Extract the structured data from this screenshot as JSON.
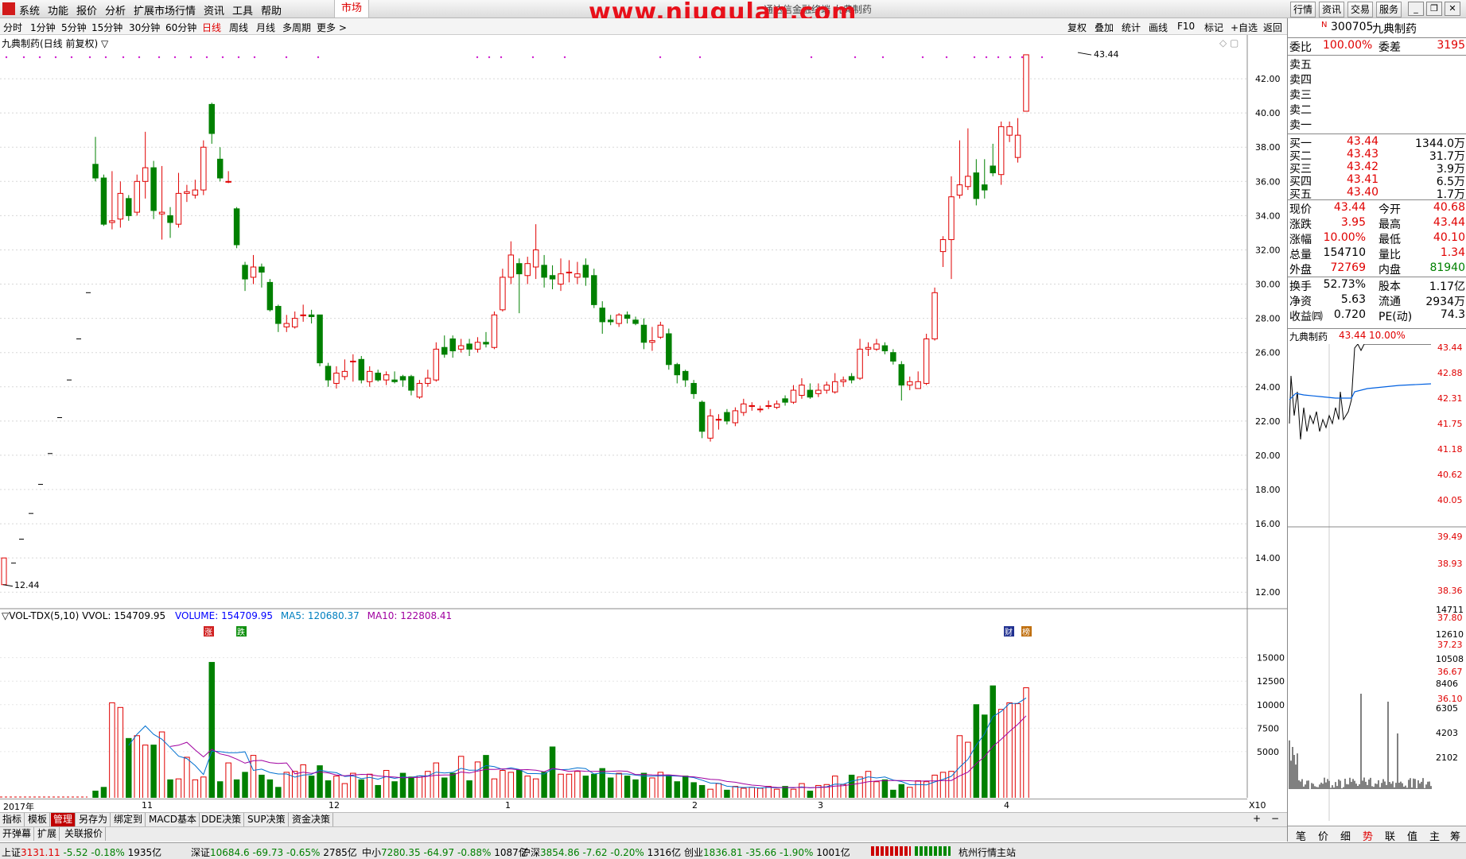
{
  "menu": [
    "系统",
    "功能",
    "报价",
    "分析",
    "扩展市场行情",
    "资讯",
    "工具",
    "帮助"
  ],
  "market": "市场",
  "watermark": "www.niugulan.com",
  "subtitle": "通达信金融终端 九典制药",
  "top_right_buttons": [
    "行情",
    "资讯",
    "交易",
    "服务"
  ],
  "periods": [
    "分时",
    "1分钟",
    "5分钟",
    "15分钟",
    "30分钟",
    "60分钟",
    "日线",
    "周线",
    "月线",
    "多周期",
    "更多 >"
  ],
  "active_period": "日线",
  "toolbar": [
    "复权",
    "叠加",
    "统计",
    "画线",
    "F10",
    "标记",
    "+自选",
    "返回"
  ],
  "chart": {
    "title": "九典制药(日线 前复权) ▽",
    "y_ticks": [
      "42.00",
      "40.00",
      "38.00",
      "36.00",
      "34.00",
      "32.00",
      "30.00",
      "28.00",
      "26.00",
      "24.00",
      "22.00",
      "20.00",
      "18.00",
      "16.00",
      "14.00",
      "12.00"
    ],
    "high_label": "43.44",
    "low_label": "12.44",
    "x_labels": [
      "2017年",
      "11",
      "12",
      "1",
      "2",
      "3",
      "4"
    ],
    "markers": [
      "涨",
      "跌",
      "财",
      "榜"
    ]
  },
  "volume": {
    "legend_name": "▽VOL-TDX(5,10) VVOL: 154709.95",
    "legend_volume": "VOLUME: 154709.95",
    "legend_ma5": "MA5: 120680.37",
    "legend_ma10": "MA10: 122808.41",
    "y_ticks": [
      "15000",
      "12500",
      "10000",
      "7500",
      "5000"
    ],
    "unit": "X10"
  },
  "tabs1": [
    "指标",
    "模板",
    "管理",
    "另存为",
    "绑定到",
    "MACD基本",
    "DDE决策",
    "SUP决策",
    "资金决策"
  ],
  "tabs2": [
    "开弹幕",
    "扩展",
    "关联报价"
  ],
  "status": {
    "sh": {
      "name": "上证",
      "value": "3131.11",
      "chg": "-5.52",
      "pct": "-0.18%",
      "amt": "1935亿"
    },
    "sz": {
      "name": "深证",
      "value": "10684.6",
      "chg": "-69.73",
      "pct": "-0.65%",
      "amt": "2785亿"
    },
    "zx": {
      "name": "中小",
      "value": "7280.35",
      "chg": "-64.97",
      "pct": "-0.88%",
      "amt": "1087亿"
    },
    "hs": {
      "name": "沪深",
      "value": "3854.86",
      "chg": "-7.62",
      "pct": "-0.20%",
      "amt": "1316亿"
    },
    "cy": {
      "name": "创业",
      "value": "1836.81",
      "chg": "-35.66",
      "pct": "-1.90%",
      "amt": "1001亿"
    },
    "station": "杭州行情主站"
  },
  "quote": {
    "code": "300705",
    "name": "九典制药",
    "weibi_label": "委比",
    "weibi": "100.00%",
    "weicha_label": "委差",
    "weicha": "3195",
    "sells": [
      {
        "label": "卖五",
        "p": "",
        "v": ""
      },
      {
        "label": "卖四",
        "p": "",
        "v": ""
      },
      {
        "label": "卖三",
        "p": "",
        "v": ""
      },
      {
        "label": "卖二",
        "p": "",
        "v": ""
      },
      {
        "label": "卖一",
        "p": "",
        "v": ""
      }
    ],
    "buys": [
      {
        "label": "买一",
        "p": "43.44",
        "v": "1344.0万"
      },
      {
        "label": "买二",
        "p": "43.43",
        "v": "31.7万"
      },
      {
        "label": "买三",
        "p": "43.42",
        "v": "3.9万"
      },
      {
        "label": "买四",
        "p": "43.41",
        "v": "6.5万"
      },
      {
        "label": "买五",
        "p": "43.40",
        "v": "1.7万"
      }
    ],
    "stats": [
      {
        "l1": "现价",
        "v1": "43.44",
        "l2": "今开",
        "v2": "40.68"
      },
      {
        "l1": "涨跌",
        "v1": "3.95",
        "l2": "最高",
        "v2": "43.44"
      },
      {
        "l1": "涨幅",
        "v1": "10.00%",
        "l2": "最低",
        "v2": "40.10"
      },
      {
        "l1": "总量",
        "v1": "154710",
        "l2": "量比",
        "v2": "1.34"
      },
      {
        "l1": "外盘",
        "v1": "72769",
        "l2": "内盘",
        "v2": "81940"
      }
    ],
    "stats2": [
      {
        "l1": "换手",
        "v1": "52.73%",
        "l2": "股本",
        "v2": "1.17亿"
      },
      {
        "l1": "净资",
        "v1": "5.63",
        "l2": "流通",
        "v2": "2934万"
      },
      {
        "l1": "收益㈣",
        "v1": "0.720",
        "l2": "PE(动)",
        "v2": "74.3"
      }
    ],
    "mini_title": "九典制药",
    "mini_price": "43.44",
    "mini_pct": "10.00%",
    "mini_prices": [
      "43.44",
      "42.88",
      "42.31",
      "41.75",
      "41.18",
      "40.62",
      "40.05",
      "39.49",
      "38.93",
      "38.36",
      "37.80",
      "37.23",
      "36.67",
      "36.10"
    ],
    "mini_vols": [
      "14711",
      "12610",
      "10508",
      "8406",
      "6305",
      "4203",
      "2102"
    ],
    "bottom_tabs": [
      "笔",
      "价",
      "细",
      "势",
      "联",
      "值",
      "主",
      "筹"
    ]
  },
  "chart_data": {
    "type": "candlestick",
    "note": "",
    "candles": [
      [
        37.0,
        36.2,
        38.6,
        36.0
      ],
      [
        36.2,
        33.5,
        36.4,
        33.4
      ],
      [
        33.6,
        33.7,
        36.6,
        33.2
      ],
      [
        33.8,
        35.3,
        36.0,
        33.3
      ],
      [
        35.0,
        34.0,
        35.2,
        33.7
      ],
      [
        34.2,
        36.0,
        36.4,
        34.0
      ],
      [
        36.0,
        36.8,
        38.9,
        35.0
      ],
      [
        36.8,
        34.3,
        37.2,
        33.8
      ],
      [
        34.1,
        34.2,
        36.9,
        32.6
      ],
      [
        34.0,
        33.6,
        34.5,
        32.7
      ],
      [
        33.5,
        35.3,
        36.5,
        33.3
      ],
      [
        35.3,
        35.4,
        35.8,
        34.8
      ],
      [
        35.2,
        35.5,
        36.1,
        35.0
      ],
      [
        35.5,
        38.0,
        38.4,
        35.2
      ],
      [
        40.5,
        38.8,
        40.6,
        38.2
      ],
      [
        37.3,
        36.2,
        38.0,
        36.0
      ],
      [
        36.0,
        36.0,
        36.6,
        35.9
      ],
      [
        34.4,
        32.3,
        34.5,
        32.1
      ],
      [
        31.1,
        30.3,
        31.3,
        29.6
      ],
      [
        30.4,
        31.0,
        31.7,
        30.0
      ],
      [
        31.0,
        30.7,
        31.2,
        29.8
      ],
      [
        30.1,
        28.5,
        30.3,
        28.4
      ],
      [
        28.7,
        27.7,
        28.8,
        27.2
      ],
      [
        27.5,
        27.7,
        28.2,
        27.2
      ],
      [
        27.5,
        28.0,
        28.4,
        27.4
      ],
      [
        28.2,
        28.2,
        28.8,
        27.8
      ],
      [
        28.2,
        28.1,
        28.5,
        27.7
      ],
      [
        28.2,
        25.4,
        28.2,
        25.2
      ],
      [
        25.2,
        24.4,
        25.4,
        24.0
      ],
      [
        24.2,
        24.8,
        25.2,
        23.9
      ],
      [
        24.6,
        24.9,
        25.6,
        24.4
      ],
      [
        25.5,
        25.5,
        25.9,
        24.3
      ],
      [
        25.6,
        24.4,
        25.8,
        24.2
      ],
      [
        24.3,
        24.9,
        25.2,
        24.0
      ],
      [
        24.8,
        24.4,
        25.0,
        24.3
      ],
      [
        24.4,
        24.7,
        24.9,
        24.1
      ],
      [
        24.4,
        24.3,
        24.9,
        24.2
      ],
      [
        24.6,
        24.4,
        24.7,
        24.0
      ],
      [
        24.6,
        23.8,
        24.7,
        23.5
      ],
      [
        23.4,
        24.2,
        24.4,
        23.3
      ],
      [
        24.2,
        24.5,
        25.0,
        24.0
      ],
      [
        24.4,
        26.2,
        26.6,
        24.3
      ],
      [
        26.3,
        25.9,
        27.0,
        25.7
      ],
      [
        26.8,
        26.1,
        27.0,
        25.7
      ],
      [
        26.2,
        26.4,
        26.8,
        26.0
      ],
      [
        26.5,
        26.2,
        26.8,
        25.8
      ],
      [
        26.2,
        26.6,
        26.9,
        26.0
      ],
      [
        26.6,
        26.5,
        27.2,
        26.3
      ],
      [
        26.3,
        28.2,
        28.4,
        26.2
      ],
      [
        28.5,
        30.4,
        30.9,
        28.4
      ],
      [
        30.4,
        31.7,
        32.5,
        30.0
      ],
      [
        31.2,
        30.6,
        31.5,
        28.3
      ],
      [
        30.5,
        31.2,
        31.6,
        30.0
      ],
      [
        31.0,
        32.0,
        33.5,
        30.3
      ],
      [
        31.1,
        30.4,
        31.7,
        29.8
      ],
      [
        30.5,
        30.3,
        31.1,
        29.7
      ],
      [
        30.0,
        30.6,
        31.5,
        29.6
      ],
      [
        30.7,
        30.7,
        31.4,
        30.1
      ],
      [
        30.4,
        30.6,
        31.3,
        30.0
      ],
      [
        31.1,
        30.4,
        31.5,
        29.9
      ],
      [
        30.5,
        28.8,
        30.9,
        28.6
      ],
      [
        28.6,
        27.8,
        29.0,
        27.1
      ],
      [
        27.9,
        27.8,
        28.2,
        27.6
      ],
      [
        27.7,
        28.2,
        28.3,
        27.5
      ],
      [
        28.2,
        28.0,
        28.4,
        27.7
      ],
      [
        27.9,
        27.7,
        28.1,
        27.6
      ],
      [
        27.6,
        26.6,
        28.0,
        26.2
      ],
      [
        26.6,
        26.7,
        27.5,
        26.1
      ],
      [
        26.9,
        27.6,
        27.8,
        26.8
      ],
      [
        27.1,
        25.3,
        27.4,
        25.0
      ],
      [
        25.3,
        24.7,
        25.4,
        24.2
      ],
      [
        24.9,
        24.4,
        25.0,
        24.0
      ],
      [
        24.2,
        23.6,
        24.4,
        23.3
      ],
      [
        23.1,
        21.4,
        23.2,
        21.0
      ],
      [
        21.0,
        22.3,
        22.7,
        20.8
      ],
      [
        22.1,
        22.1,
        22.4,
        21.5
      ],
      [
        22.5,
        22.0,
        22.7,
        21.8
      ],
      [
        21.9,
        22.6,
        22.8,
        21.7
      ],
      [
        22.5,
        23.0,
        23.3,
        22.3
      ],
      [
        22.9,
        22.9,
        23.1,
        22.6
      ],
      [
        22.7,
        22.7,
        22.9,
        22.5
      ],
      [
        22.9,
        22.9,
        23.2,
        22.7
      ],
      [
        22.8,
        23.0,
        23.2,
        22.7
      ],
      [
        23.3,
        23.1,
        23.5,
        22.9
      ],
      [
        23.1,
        23.8,
        24.1,
        23.0
      ],
      [
        23.5,
        24.1,
        24.5,
        23.3
      ],
      [
        23.8,
        23.4,
        24.2,
        23.3
      ],
      [
        23.6,
        23.8,
        24.2,
        23.4
      ],
      [
        23.8,
        24.1,
        24.3,
        23.6
      ],
      [
        23.7,
        24.3,
        24.8,
        23.6
      ],
      [
        24.3,
        24.4,
        24.6,
        24.0
      ],
      [
        24.6,
        24.4,
        24.8,
        24.2
      ],
      [
        24.5,
        26.2,
        26.8,
        24.4
      ],
      [
        26.2,
        26.3,
        26.6,
        25.8
      ],
      [
        26.2,
        26.5,
        26.8,
        26.1
      ],
      [
        26.4,
        26.1,
        26.6,
        25.9
      ],
      [
        26.0,
        25.5,
        26.2,
        25.3
      ],
      [
        25.3,
        24.1,
        25.5,
        23.2
      ],
      [
        24.1,
        24.3,
        24.6,
        23.8
      ],
      [
        23.9,
        24.3,
        24.9,
        23.9
      ],
      [
        24.2,
        26.8,
        27.1,
        24.1
      ],
      [
        26.8,
        29.5,
        29.8,
        26.7
      ],
      [
        31.9,
        32.6,
        32.8,
        31.0
      ],
      [
        32.6,
        35.1,
        36.3,
        30.3
      ],
      [
        35.2,
        35.8,
        38.4,
        35.0
      ],
      [
        35.7,
        36.3,
        39.1,
        35.5
      ],
      [
        36.5,
        35.0,
        37.3,
        34.6
      ],
      [
        35.8,
        35.5,
        37.3,
        35.0
      ],
      [
        36.9,
        36.5,
        38.2,
        36.3
      ],
      [
        36.4,
        39.2,
        39.5,
        35.8
      ],
      [
        38.7,
        39.2,
        39.5,
        38.3
      ],
      [
        37.4,
        38.7,
        39.7,
        37.1
      ],
      [
        40.1,
        43.4,
        43.4,
        40.1
      ]
    ],
    "volume": [
      800,
      1200,
      10200,
      9700,
      6400,
      6700,
      5700,
      5700,
      7100,
      2000,
      2100,
      4400,
      2000,
      2300,
      14500,
      1800,
      3800,
      2000,
      2800,
      4600,
      2500,
      2000,
      1200,
      2800,
      2900,
      3600,
      2400,
      3500,
      1900,
      2400,
      1600,
      2700,
      2000,
      2600,
      1400,
      3000,
      1800,
      2700,
      2300,
      2400,
      2900,
      3800,
      2200,
      2700,
      4500,
      1900,
      3900,
      4600,
      2100,
      3000,
      2800,
      3000,
      2400,
      2100,
      2800,
      5500,
      2600,
      2600,
      2900,
      2400,
      2600,
      3200,
      2200,
      2700,
      2400,
      2000,
      2700,
      2200,
      2800,
      2500,
      1800,
      2400,
      1700,
      1400,
      1000,
      1600,
      900,
      1300,
      1100,
      1200,
      1100,
      1300,
      1000,
      1300,
      1000,
      1600,
      800,
      1400,
      1500,
      2400,
      1500,
      2500,
      2300,
      2900,
      1800,
      2000,
      900,
      1500,
      1200,
      1900,
      1800,
      2500,
      2800,
      2900,
      6700,
      6000,
      10000,
      8900,
      12000,
      9500,
      10200,
      10100,
      11800
    ],
    "ylim": [
      11.5,
      44
    ],
    "x_labels": [
      "2017年",
      "11",
      "12",
      "1",
      "2",
      "3",
      "4"
    ]
  }
}
